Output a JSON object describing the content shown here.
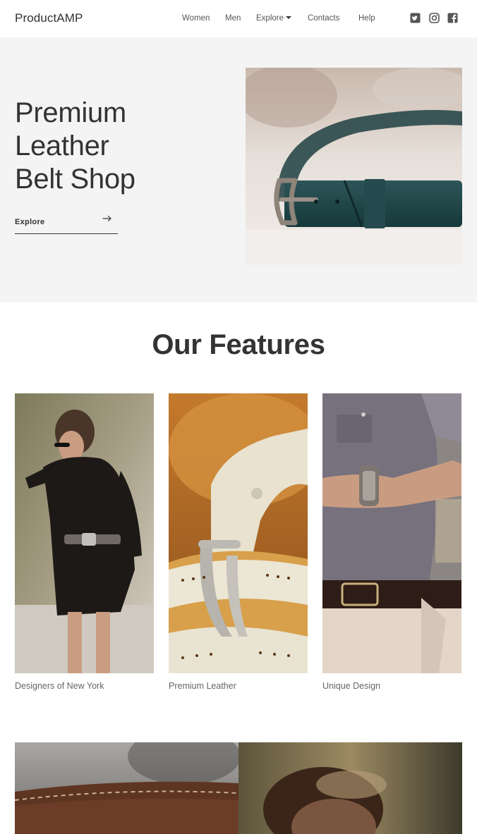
{
  "header": {
    "logo": "ProductAMP",
    "nav": {
      "women": "Women",
      "men": "Men",
      "explore": "Explore",
      "contacts": "Contacts",
      "help": "Help"
    },
    "social_icons": [
      "twitter-icon",
      "instagram-icon",
      "facebook-icon"
    ]
  },
  "hero": {
    "title_line1": "Premium",
    "title_line2": "Leather",
    "title_line3": "Belt Shop",
    "cta_label": "Explore",
    "cta_icon": "arrow-right-icon",
    "background": "#f4f4f4"
  },
  "features": {
    "title": "Our Features",
    "items": [
      {
        "caption": "Designers of New York"
      },
      {
        "caption": "Premium Leather"
      },
      {
        "caption": "Unique Design"
      }
    ]
  },
  "colors": {
    "text_dark": "#333333",
    "text_muted": "#666666",
    "hero_bg": "#f4f4f4"
  }
}
